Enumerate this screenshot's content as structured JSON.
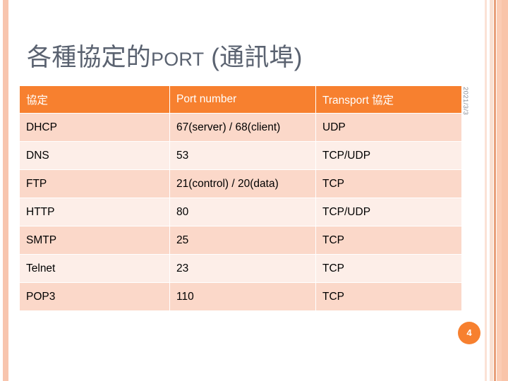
{
  "slide": {
    "title_prefix": "各種協定的",
    "title_smallcaps": "PORT",
    "title_suffix": " (通訊埠)",
    "date": "2021/3/3",
    "page_number": "4",
    "accent_color": "#F7802F",
    "row_dark_color": "#FBD8C9",
    "row_light_color": "#FDEEE8",
    "title_color": "#5A6270",
    "edge_bar_color": "#F8C5AE"
  },
  "table": {
    "headers": [
      "協定",
      "Port number",
      "Transport 協定"
    ],
    "rows": [
      [
        "DHCP",
        "67(server) / 68(client)",
        "UDP"
      ],
      [
        "DNS",
        "53",
        "TCP/UDP"
      ],
      [
        "FTP",
        "21(control) / 20(data)",
        "TCP"
      ],
      [
        "HTTP",
        "80",
        "TCP/UDP"
      ],
      [
        "SMTP",
        "25",
        "TCP"
      ],
      [
        "Telnet",
        "23",
        "TCP"
      ],
      [
        "POP3",
        "110",
        "TCP"
      ]
    ]
  }
}
